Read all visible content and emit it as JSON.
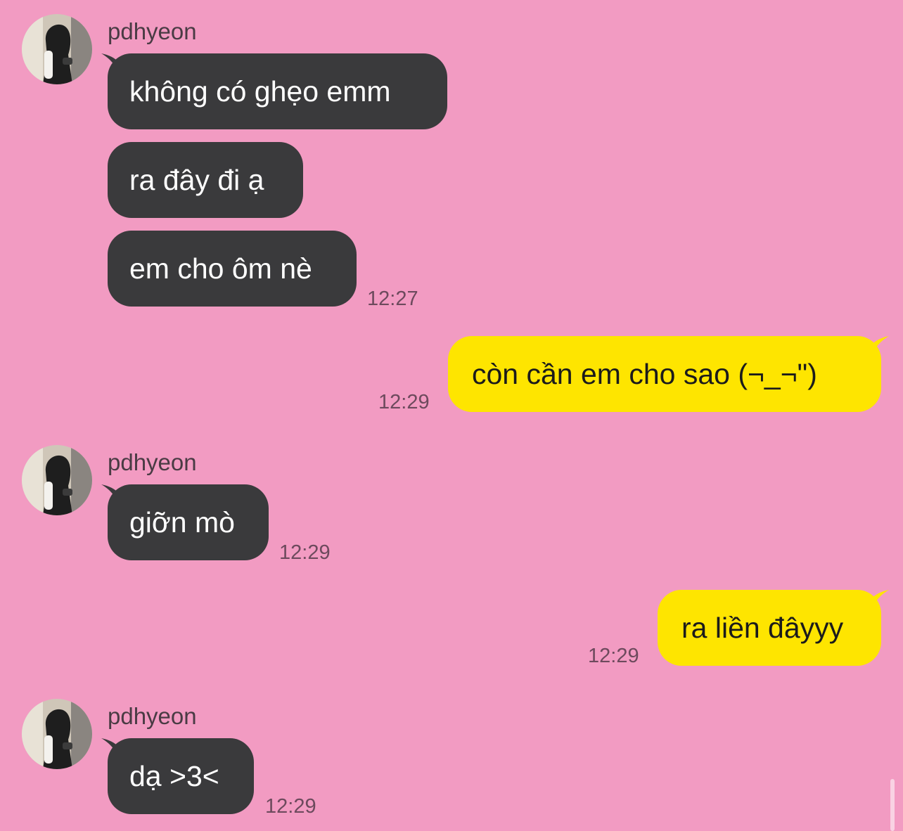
{
  "chat": {
    "groups": [
      {
        "sender": "pdhyeon",
        "messages": [
          "không có ghẹo emm",
          "ra đây đi ạ",
          "em cho ôm nè"
        ],
        "time": "12:27"
      },
      {
        "me": true,
        "messages": [
          "còn cần em cho sao (¬_¬\")"
        ],
        "time": "12:29"
      },
      {
        "sender": "pdhyeon",
        "messages": [
          "giỡn mò"
        ],
        "time": "12:29"
      },
      {
        "me": true,
        "messages": [
          "ra liền đâyyy"
        ],
        "time": "12:29"
      },
      {
        "sender": "pdhyeon",
        "messages": [
          "dạ >3<"
        ],
        "time": "12:29"
      }
    ]
  },
  "colors": {
    "background": "#f29bc2",
    "incoming_bubble": "#3a3a3c",
    "outgoing_bubble": "#fee500"
  },
  "icons": {
    "avatar": "profile-photo-hooded-person"
  }
}
